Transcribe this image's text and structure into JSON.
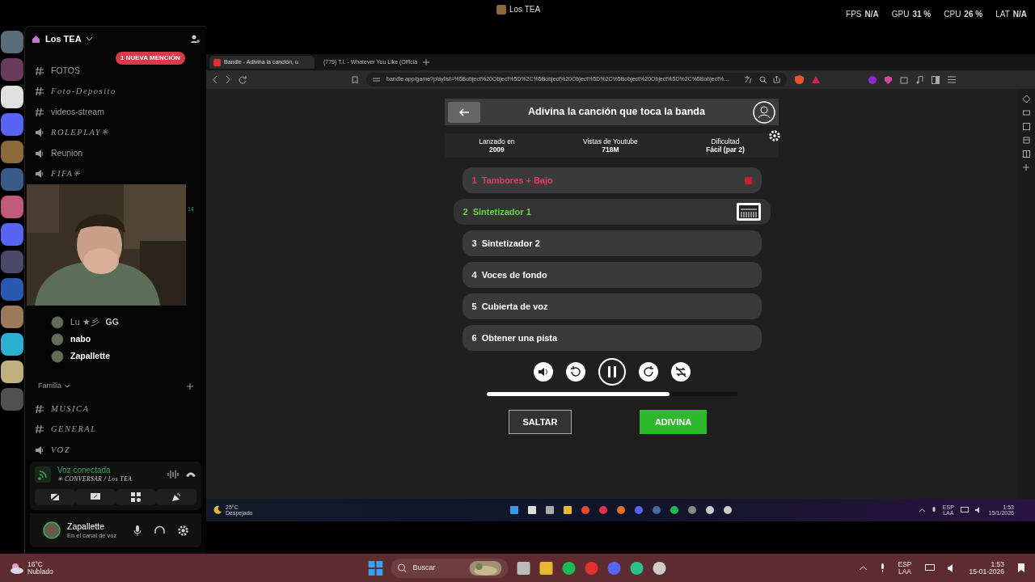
{
  "top_bar": {
    "title": "Los TEA",
    "stats": [
      {
        "label": "FPS",
        "value": "N/A"
      },
      {
        "label": "GPU",
        "value": "31 %"
      },
      {
        "label": "CPU",
        "value": "26 %"
      },
      {
        "label": "LAT",
        "value": "N/A"
      }
    ]
  },
  "discord": {
    "server_name": "Los TEA",
    "mention_badge": "1 NUEVA MENCIÓN",
    "servers": [
      {
        "color": "#5a6b7a"
      },
      {
        "color": "#6a3a5a"
      },
      {
        "color": "#e0e0e0"
      },
      {
        "color": "#5865f2"
      },
      {
        "color": "#8a6a3a"
      },
      {
        "color": "#3a5a8a"
      },
      {
        "color": "#c05a7a"
      },
      {
        "color": "#5865f2"
      },
      {
        "color": "#4a4a6a"
      },
      {
        "color": "#2a5ab0"
      },
      {
        "color": "#9a7a5a"
      },
      {
        "color": "#2ab0d0"
      },
      {
        "color": "#c0b080"
      },
      {
        "color": "#505050"
      }
    ],
    "channels": [
      {
        "kind": "text",
        "name": "FOTOS",
        "fancy": false
      },
      {
        "kind": "text",
        "name": "Foto-Deposito",
        "fancy": true
      },
      {
        "kind": "text",
        "name": "videos-stream",
        "fancy": false
      },
      {
        "kind": "voice",
        "name": "ROLEPLAY✳",
        "fancy": true
      },
      {
        "kind": "voice",
        "name": "Reunion",
        "fancy": false
      },
      {
        "kind": "voice",
        "name": "FIFA✳",
        "fancy": true
      }
    ],
    "side_count": "14",
    "voice_users": [
      {
        "name": "Lu ★彡",
        "tag": "GG",
        "bold": false
      },
      {
        "name": "nabo",
        "bold": true
      },
      {
        "name": "Zapallette",
        "bold": true
      }
    ],
    "category": "Familia",
    "category_channels": [
      {
        "kind": "text",
        "name": "MUSICA"
      },
      {
        "kind": "text",
        "name": "GENERAL"
      },
      {
        "kind": "voice",
        "name": "VOZ"
      }
    ],
    "voice_panel": {
      "status": "Voz conectada",
      "channel": "✳ CONVERSAR / Los TEA"
    },
    "user": {
      "name": "Zapallette",
      "status": "En el canal de voz"
    }
  },
  "browser": {
    "tabs": [
      {
        "title": "Bandle - Adivina la canción, u",
        "selected": true
      },
      {
        "title": "(779) T.I. - Whatever You Like (Officia",
        "selected": false
      }
    ],
    "url": "bandle.app/game?playlist=%5Bobject%20Object%5D%2C%5Bobject%20Object%5D%2C%5Bobject%20Object%5D%2C%5Bobject%..."
  },
  "game": {
    "title": "Adivina la canción que toca la banda",
    "stats": [
      {
        "label": "Lanzado en",
        "value": "2009"
      },
      {
        "label": "Vistas de Youtube",
        "value": "718M"
      },
      {
        "label": "Dificultad",
        "value": "Fácil (par 2)"
      }
    ],
    "tracks": [
      {
        "number": "1",
        "name": "Tambores + Bajo",
        "kind": "wrong"
      },
      {
        "number": "2",
        "name": "Sintetizador 1",
        "kind": "current"
      },
      {
        "number": "3",
        "name": "Sintetizador 2",
        "kind": "pending"
      },
      {
        "number": "4",
        "name": "Voces de fondo",
        "kind": "pending"
      },
      {
        "number": "5",
        "name": "Cubierta de voz",
        "kind": "pending"
      },
      {
        "number": "6",
        "name": "Obtener una pista",
        "kind": "pending"
      }
    ],
    "playing": true,
    "progress": {
      "level": 0.73
    },
    "skip_button": "SALTAR",
    "guess_button": "ADIVINA"
  },
  "inner_taskbar": {
    "temperature": "25°C",
    "weather": "Despejado",
    "lang": "ESP",
    "layout": "LAA",
    "time": "1:53",
    "date": "15/1/2026"
  },
  "taskbar": {
    "temperature": "16°C",
    "weather": "Nublado",
    "search": "Buscar",
    "lang": "ESP",
    "layout": "LAA",
    "time": "1:53",
    "date": "15-01-2026"
  }
}
